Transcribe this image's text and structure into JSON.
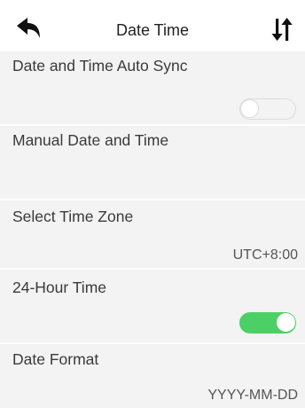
{
  "header": {
    "title": "Date Time",
    "back_icon": "back-arrow-icon",
    "sort_icon": "sort-arrows-icon"
  },
  "settings": [
    {
      "label": "Date and Time Auto Sync",
      "control": "toggle",
      "enabled": false
    },
    {
      "label": "Manual Date and Time"
    },
    {
      "label": "Select Time Zone",
      "value": "UTC+8:00"
    },
    {
      "label": "24-Hour Time",
      "control": "toggle",
      "enabled": true
    },
    {
      "label": "Date Format",
      "value": "YYYY-MM-DD"
    }
  ],
  "colors": {
    "toggle_on": "#4cd065",
    "toggle_off_border": "#dcdcdc",
    "row_background": "#f3f3f3",
    "header_background": "#ffffff"
  }
}
